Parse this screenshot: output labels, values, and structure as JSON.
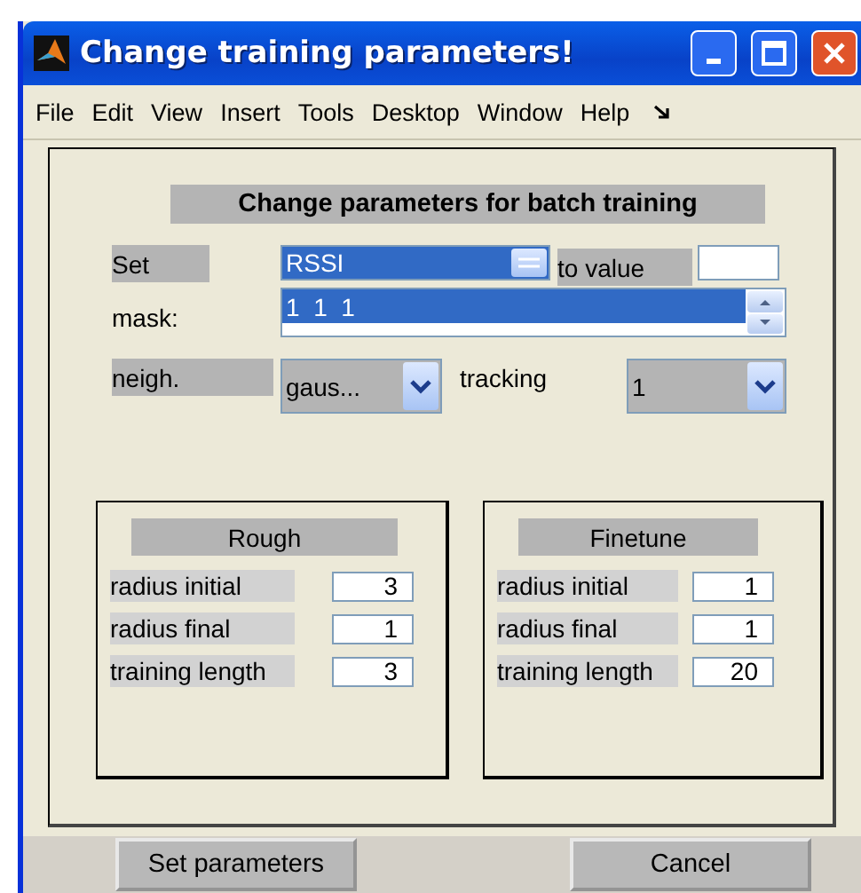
{
  "window": {
    "title": "Change training parameters!"
  },
  "menu": [
    "File",
    "Edit",
    "View",
    "Insert",
    "Tools",
    "Desktop",
    "Window",
    "Help"
  ],
  "heading": "Change parameters for batch training",
  "set": {
    "label": "Set",
    "popup": {
      "value": "RSSI",
      "highlighted": true
    },
    "to_label": "to value"
  },
  "mask": {
    "label": "mask:",
    "items": [
      {
        "text": "1  1  1",
        "selected": true
      }
    ]
  },
  "neigh": {
    "label": "neigh.",
    "popup": {
      "value": "gaus...",
      "highlighted": false
    }
  },
  "tracking": {
    "label": "tracking",
    "popup": {
      "value": "1",
      "highlighted": false
    }
  },
  "panels": [
    {
      "title": "Rough",
      "rows": [
        {
          "label": "radius initial",
          "value": "3"
        },
        {
          "label": "radius final",
          "value": "1"
        },
        {
          "label": "training length",
          "value": "3"
        }
      ]
    },
    {
      "title": "Finetune",
      "rows": [
        {
          "label": "radius initial",
          "value": "1"
        },
        {
          "label": "radius final",
          "value": "1"
        },
        {
          "label": "training length",
          "value": "20"
        }
      ]
    }
  ],
  "buttons": [
    "Set parameters",
    "Cancel"
  ]
}
